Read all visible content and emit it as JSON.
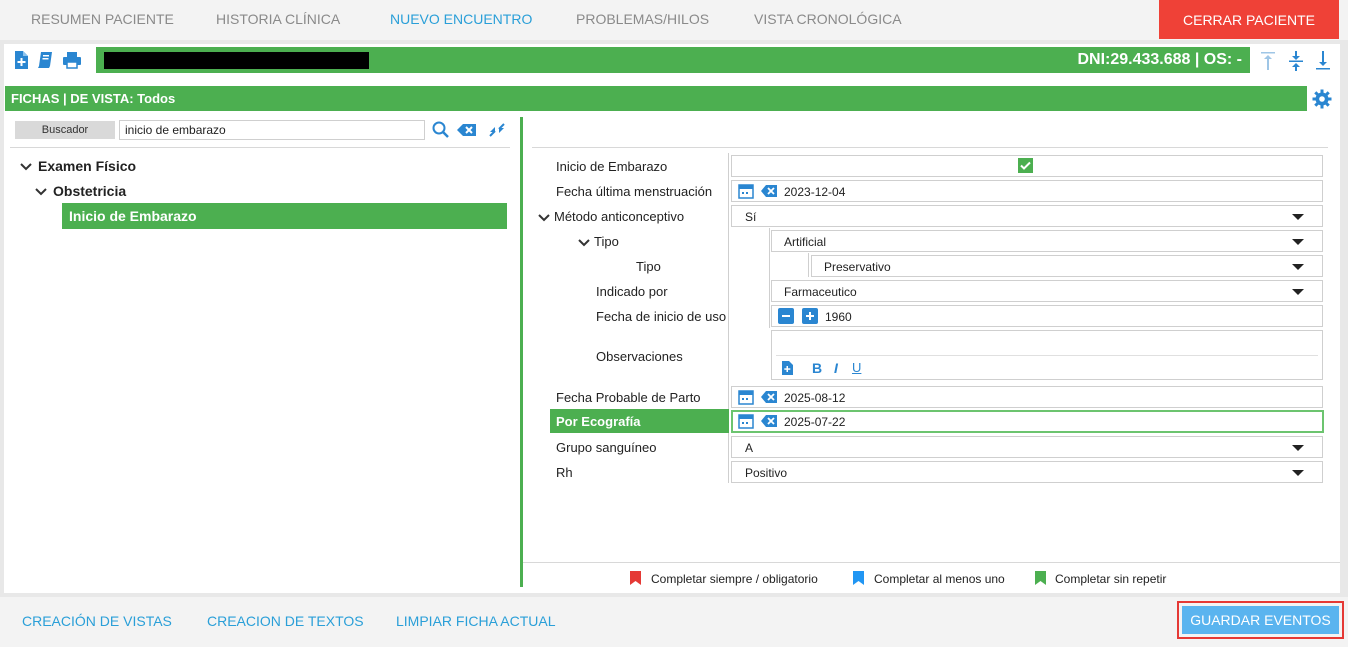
{
  "tabs": [
    {
      "label": "RESUMEN PACIENTE",
      "active": false
    },
    {
      "label": "HISTORIA CLÍNICA",
      "active": false
    },
    {
      "label": "NUEVO ENCUENTRO",
      "active": true
    },
    {
      "label": "PROBLEMAS/HILOS",
      "active": false
    },
    {
      "label": "VISTA CRONOLÓGICA",
      "active": false
    }
  ],
  "close_label": "CERRAR PACIENTE",
  "patient": {
    "id_text": "DNI:29.433.688 | OS: -"
  },
  "fichas_title": "FICHAS | DE VISTA: Todos",
  "search": {
    "label": "Buscador",
    "value": "inicio de embarazo"
  },
  "tree": {
    "level1": "Examen Físico",
    "level2": "Obstetricia",
    "selected": "Inicio de Embarazo"
  },
  "form": {
    "inicio_label": "Inicio de Embarazo",
    "fum_label": "Fecha última menstruación",
    "fum_value": "2023-12-04",
    "metodo_label": "Método anticonceptivo",
    "metodo_value": "Sí",
    "tipo_label": "Tipo",
    "tipo_value": "Artificial",
    "subtipo_label": "Tipo",
    "subtipo_value": "Preservativo",
    "indicado_label": "Indicado por",
    "indicado_value": "Farmaceutico",
    "inicio_uso_label": "Fecha de inicio de uso",
    "inicio_uso_value": "1960",
    "obs_label": "Observaciones",
    "fpp_label": "Fecha Probable de Parto",
    "fpp_value": "2025-08-12",
    "eco_label": "Por Ecografía",
    "eco_value": "2025-07-22",
    "grupo_label": "Grupo sanguíneo",
    "grupo_value": "A",
    "rh_label": "Rh",
    "rh_value": "Positivo"
  },
  "legend": [
    {
      "label": "Completar siempre / obligatorio",
      "color": "#e53935"
    },
    {
      "label": "Completar al menos uno",
      "color": "#2196f3"
    },
    {
      "label": "Completar sin repetir",
      "color": "#4caf50"
    }
  ],
  "bottom": {
    "creacion_vistas": "CREACIÓN DE VISTAS",
    "creacion_textos": "CREACION DE TEXTOS",
    "limpiar": "LIMPIAR FICHA ACTUAL",
    "guardar": "GUARDAR EVENTOS"
  },
  "colors": {
    "green": "#4caf50",
    "blue": "#2a9fd8",
    "red": "#ef4137",
    "save": "#5ab4ef"
  },
  "icons": [
    "new-document-icon",
    "book-icon",
    "print-icon",
    "scroll-top-icon",
    "collapse-icon",
    "scroll-bottom-icon",
    "settings-icon",
    "search-icon",
    "clear-icon",
    "shrink-icon",
    "calendar-icon",
    "minus-icon",
    "plus-icon",
    "bold-icon",
    "italic-icon",
    "underline-icon",
    "checkmark-icon"
  ]
}
